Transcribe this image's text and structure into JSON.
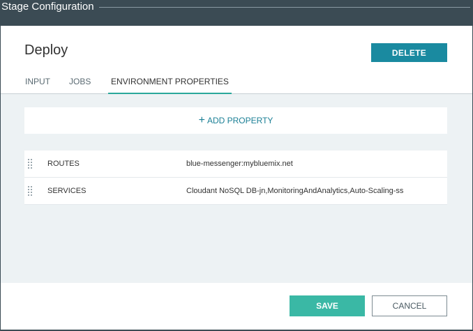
{
  "window": {
    "title": "Stage Configuration"
  },
  "stage": {
    "name": "Deploy",
    "delete_label": "DELETE"
  },
  "tabs": [
    {
      "label": "INPUT",
      "active": false
    },
    {
      "label": "JOBS",
      "active": false
    },
    {
      "label": "ENVIRONMENT PROPERTIES",
      "active": true
    }
  ],
  "add_property": {
    "icon": "plus-icon",
    "label": "ADD PROPERTY"
  },
  "properties": [
    {
      "key": "ROUTES",
      "value": "blue-messenger:mybluemix.net"
    },
    {
      "key": "SERVICES",
      "value": "Cloudant NoSQL DB-jn,MonitoringAndAnalytics,Auto-Scaling-ss"
    }
  ],
  "footer": {
    "save_label": "SAVE",
    "cancel_label": "CANCEL"
  },
  "colors": {
    "titlebar": "#3b4b54",
    "accent": "#1a8aa0",
    "save": "#3ab8a5",
    "tab_underline": "#2aa89a",
    "content_bg": "#edf2f4"
  }
}
